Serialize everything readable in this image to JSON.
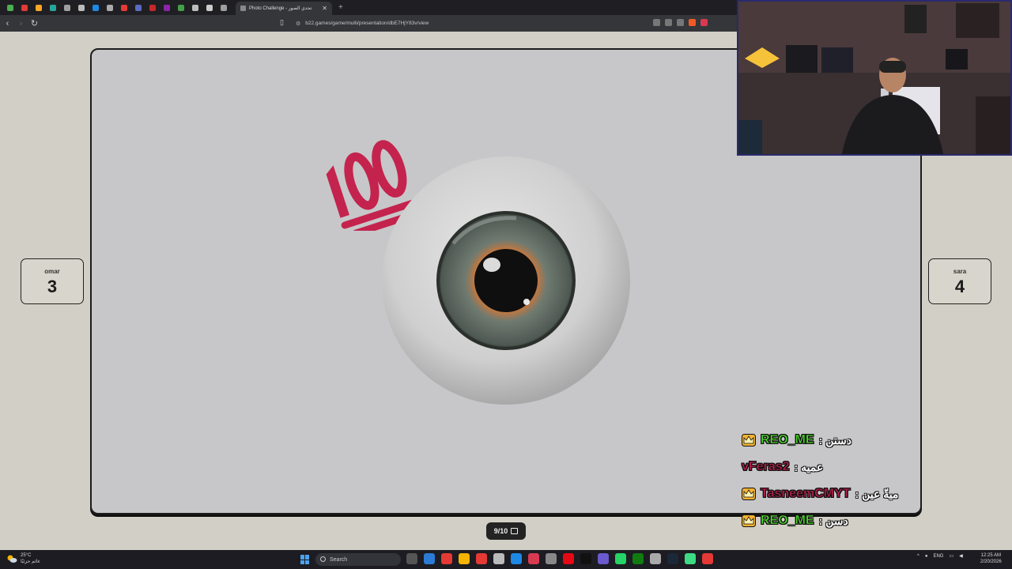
{
  "browser": {
    "tab_title": "Photo Challenge - تحدي الصور",
    "url": "b22.games/game/multi/presentation/dbE7HjY83v/view",
    "pinned_tab_colors": [
      "#4caf50",
      "#e53935",
      "#f9a825",
      "#26a69a",
      "#9e9e9e",
      "#bbbbbb",
      "#1e88e5",
      "#aaaaaa",
      "#e53935",
      "#5c6bc0",
      "#c62828",
      "#8e24aa",
      "#43a047",
      "#bdbdbd",
      "#cccccc",
      "#9e9e9e"
    ]
  },
  "game": {
    "players": [
      {
        "name": "omar",
        "score": "3"
      },
      {
        "name": "sara",
        "score": "4"
      }
    ],
    "progress": "9/10",
    "progress_value": 0.9,
    "image_content": [
      "hundred-points-emoji",
      "eyeball"
    ]
  },
  "chat": {
    "messages": [
      {
        "user": "REO_ME",
        "message": ": دستن",
        "badge": "crown",
        "user_color": "#4cd62a"
      },
      {
        "user": "vFeras2",
        "message": ": عميه",
        "badge": "",
        "user_color": "#b21f4a"
      },
      {
        "user": "TasneemCMYT",
        "message": ": ميةّ عين",
        "badge": "crown",
        "user_color": "#b21f4a"
      },
      {
        "user": "REO_ME",
        "message": ": دسن",
        "badge": "crown",
        "user_color": "#4cd62a"
      }
    ]
  },
  "taskbar": {
    "weather_temp": "25°C",
    "weather_desc": "غائم جزئيًا",
    "search_placeholder": "Search",
    "language": "ENG",
    "time": "12:25 AM",
    "date": "2/20/2026",
    "app_icon_colors": [
      "#555",
      "#2b7bd6",
      "#e53935",
      "#f5b400",
      "#e53935",
      "#bbb",
      "#1e88e5",
      "#d83a52",
      "#888",
      "#e50914",
      "#111",
      "#6a5acd",
      "#25d366",
      "#107c10",
      "#aaa",
      "#1b2838",
      "#3ddc84",
      "#e53935"
    ]
  }
}
